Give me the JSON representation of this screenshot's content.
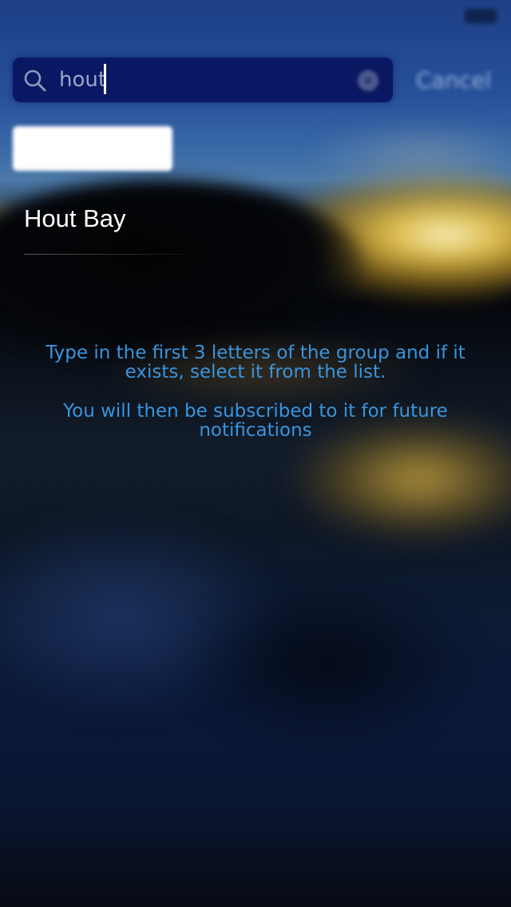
{
  "status_bar": {
    "carrier": "",
    "time": ""
  },
  "search": {
    "value": "hout",
    "cancel_label": "Cancel"
  },
  "segments": [
    {
      "label": "",
      "selected": true
    },
    {
      "label": "",
      "selected": false
    },
    {
      "label": "",
      "selected": false
    }
  ],
  "results": [
    {
      "label": "Hout Bay"
    }
  ],
  "instructions": {
    "line1": "Type in the first 3 letters of the group and if it exists, select it from the list.",
    "line2": "You will then be subscribed to it for future notifications"
  },
  "bottom_button_label": "",
  "colors": {
    "search_background": "#08145f",
    "instruction_text": "#3a94dc",
    "result_text": "#ffffff"
  }
}
